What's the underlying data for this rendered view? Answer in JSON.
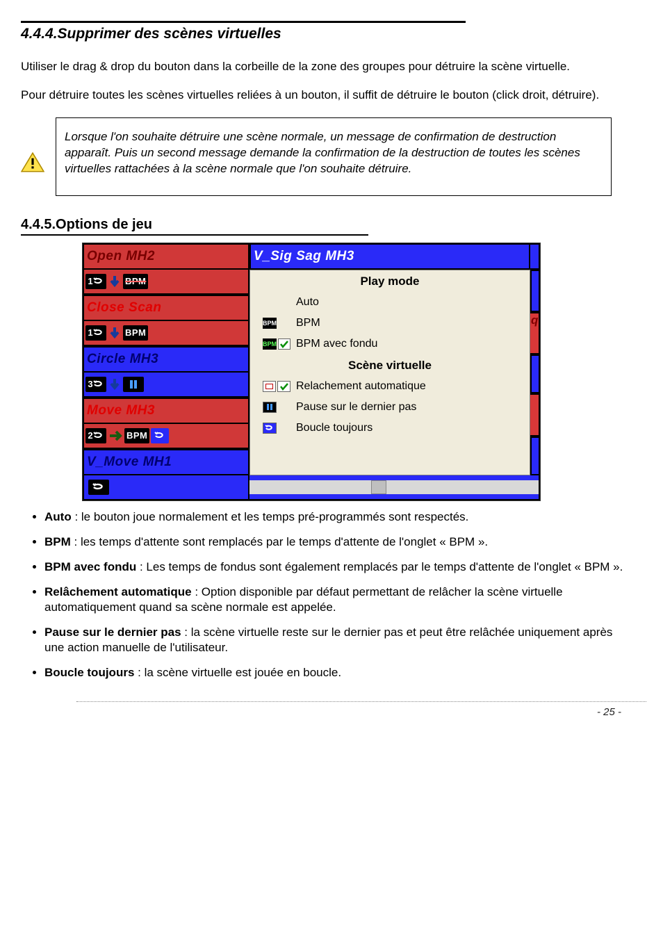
{
  "section1": {
    "heading": "4.4.4.Supprimer des scènes virtuelles",
    "para1": "Utiliser le drag & drop du bouton dans la corbeille de la zone des groupes pour détruire la scène virtuelle.",
    "para2": "Pour détruire toutes les scènes virtuelles reliées à un bouton, il suffit de détruire le bouton (click droit, détruire)."
  },
  "warning": "Lorsque l'on souhaite détruire une scène normale, un message de confirmation de destruction apparaît. Puis un second message demande la confirmation de la destruction de toutes les scènes virtuelles rattachées à la scène normale que l'on souhaite détruire.",
  "section2": {
    "heading": "4.4.5.Options de jeu",
    "bullets": [
      {
        "term": "Auto",
        "rest": " : le bouton joue normalement et les temps pré-programmés sont respectés."
      },
      {
        "term": "BPM",
        "rest": " : les temps d'attente sont remplacés par le temps d'attente de l'onglet « BPM »."
      },
      {
        "term": "BPM avec fondu",
        "rest": " : Les temps de fondus sont également remplacés par le temps d'attente de l'onglet « BPM »."
      },
      {
        "term": "Relâchement automatique",
        "rest": " : Option disponible par défaut permettant de relâcher la scène virtuelle automatiquement quand sa scène normale est appelée."
      },
      {
        "term": "Pause sur le dernier pas",
        "rest": " : la scène virtuelle reste sur le dernier pas et peut être relâchée uniquement après une action manuelle de l'utilisateur."
      },
      {
        "term": "Boucle toujours",
        "rest": " : la scène virtuelle est jouée en boucle."
      }
    ]
  },
  "figure": {
    "left": [
      {
        "name": "Open MH2",
        "bg": "red",
        "nameColor": "top-red",
        "icons": [
          "loop1",
          "down",
          "bpm-strike"
        ]
      },
      {
        "name": "Close Scan",
        "bg": "red",
        "nameColor": "active",
        "icons": [
          "loop1",
          "down",
          "bpm"
        ]
      },
      {
        "name": "Circle MH3",
        "bg": "blue",
        "nameColor": "normal-blue",
        "icons": [
          "loop3",
          "down",
          "pause"
        ]
      },
      {
        "name": "Move MH3",
        "bg": "red",
        "nameColor": "active",
        "icons": [
          "loop2",
          "right",
          "bpm",
          "loopblue"
        ]
      },
      {
        "name": "V_Move MH1",
        "bg": "blue",
        "nameColor": "normal-blue",
        "icons": [
          "always"
        ]
      }
    ],
    "rightTop": {
      "name": "V_Sig Sag MH3"
    },
    "menu": {
      "title1": "Play mode",
      "rows1": [
        {
          "icons": [],
          "label": "Auto"
        },
        {
          "icons": [
            "bpm-black"
          ],
          "label": "BPM"
        },
        {
          "icons": [
            "bpm-green",
            "check"
          ],
          "label": "BPM avec fondu"
        }
      ],
      "title2": "Scène virtuelle",
      "rows2": [
        {
          "icons": [
            "stopsq",
            "check"
          ],
          "label": "Relachement automatique"
        },
        {
          "icons": [
            "pausebars"
          ],
          "label": "Pause sur le dernier pas"
        },
        {
          "icons": [
            "loopblue"
          ],
          "label": "Boucle toujours"
        }
      ]
    },
    "rightSliver": "q"
  },
  "footer": "- 25 -"
}
